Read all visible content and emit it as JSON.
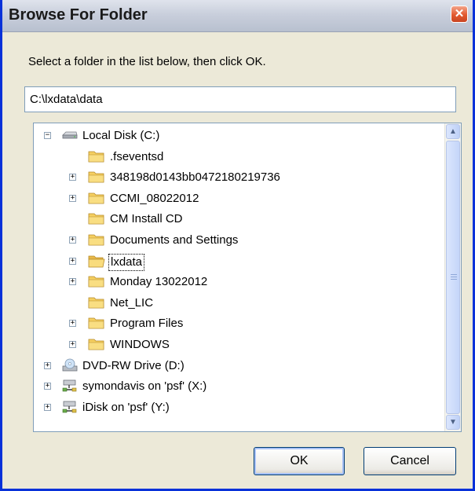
{
  "window": {
    "title": "Browse For Folder",
    "close_glyph": "✕"
  },
  "instruction": "Select a folder in the list below, then click OK.",
  "path_value": "C:\\lxdata\\data",
  "tree": {
    "items": [
      {
        "label": "Local Disk (C:)",
        "icon": "hard-drive-icon",
        "expander": "⊟"
      },
      {
        "label": ".fseventsd",
        "icon": "folder-icon",
        "expander": ""
      },
      {
        "label": "348198d0143bb0472180219736",
        "icon": "folder-icon",
        "expander": "+"
      },
      {
        "label": "CCMI_08022012",
        "icon": "folder-icon",
        "expander": "+"
      },
      {
        "label": "CM Install CD",
        "icon": "folder-icon",
        "expander": ""
      },
      {
        "label": "Documents and Settings",
        "icon": "folder-icon",
        "expander": "+"
      },
      {
        "label": "lxdata",
        "icon": "folder-open-icon",
        "expander": "+",
        "selected": true
      },
      {
        "label": "Monday 13022012",
        "icon": "folder-icon",
        "expander": "+"
      },
      {
        "label": "Net_LIC",
        "icon": "folder-icon",
        "expander": ""
      },
      {
        "label": "Program Files",
        "icon": "folder-icon",
        "expander": "+"
      },
      {
        "label": "WINDOWS",
        "icon": "folder-icon",
        "expander": "+"
      },
      {
        "label": "DVD-RW Drive (D:)",
        "icon": "dvd-drive-icon",
        "expander": "+"
      },
      {
        "label": "symondavis on 'psf' (X:)",
        "icon": "network-drive-icon",
        "expander": "+"
      },
      {
        "label": "iDisk on 'psf' (Y:)",
        "icon": "network-drive-icon",
        "expander": "+"
      }
    ]
  },
  "scrollbar": {
    "up": "▲",
    "down": "▼"
  },
  "buttons": {
    "ok": "OK",
    "cancel": "Cancel"
  },
  "colors": {
    "title_border": "#0831d9",
    "dialog_bg": "#ece9d8",
    "folder": "#f7d36b",
    "close": "#e2592f"
  }
}
